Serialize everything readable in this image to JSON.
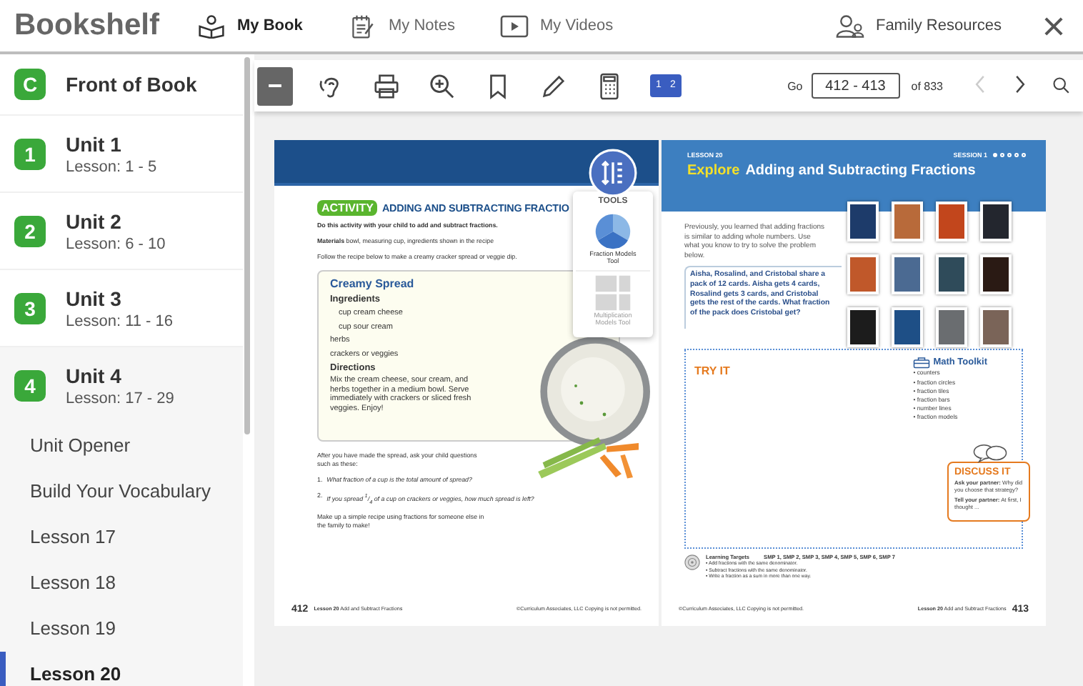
{
  "app": {
    "title": "Bookshelf"
  },
  "nav_tabs": [
    {
      "kind": "book",
      "label": "My Book",
      "selected": true
    },
    {
      "kind": "notes",
      "label": "My Notes",
      "selected": false
    },
    {
      "kind": "videos",
      "label": "My Videos",
      "selected": false
    }
  ],
  "family_resources": {
    "label": "Family Resources"
  },
  "sidebar": {
    "units": [
      {
        "badge": "C",
        "title": "Front of Book",
        "expanded": false
      },
      {
        "badge": "1",
        "title": "Unit 1",
        "subtitle": "Lesson: 1 - 5",
        "expanded": false
      },
      {
        "badge": "2",
        "title": "Unit 2",
        "subtitle": "Lesson: 6 - 10",
        "expanded": false
      },
      {
        "badge": "3",
        "title": "Unit 3",
        "subtitle": "Lesson: 11 - 16",
        "expanded": false
      },
      {
        "badge": "4",
        "title": "Unit 4",
        "subtitle": "Lesson: 17 - 29",
        "expanded": true,
        "children": [
          {
            "label": "Unit Opener",
            "selected": false
          },
          {
            "label": "Build Your Vocabulary",
            "selected": false
          },
          {
            "label": "Lesson 17",
            "selected": false
          },
          {
            "label": "Lesson 18",
            "selected": false
          },
          {
            "label": "Lesson 19",
            "selected": false
          },
          {
            "label": "Lesson 20",
            "selected": true
          }
        ]
      }
    ]
  },
  "toolbar": {
    "tools": [
      {
        "kind": "collapse",
        "selected": true
      },
      {
        "kind": "listen",
        "selected": false
      },
      {
        "kind": "print",
        "selected": false
      },
      {
        "kind": "zoom",
        "selected": false
      },
      {
        "kind": "bookmark",
        "selected": false
      },
      {
        "kind": "pencil",
        "selected": false
      },
      {
        "kind": "calculator",
        "selected": false
      }
    ],
    "two_page": {
      "labels": [
        "1",
        "2"
      ],
      "selected": true
    },
    "go_label": "Go",
    "page_field": "412 - 413",
    "page_total": "of 833",
    "pager": [
      {
        "kind": "prev",
        "disabled": true
      },
      {
        "kind": "next",
        "disabled": false
      }
    ]
  },
  "tools_popup": {
    "title": "TOOLS",
    "items": [
      {
        "kind": "pie",
        "label": "Fraction Models Tool",
        "disabled": false
      },
      {
        "kind": "grid",
        "label": "Multiplication Models Tool",
        "disabled": true
      }
    ]
  },
  "left_page": {
    "badge": "ACTIVITY",
    "title": "ADDING AND SUBTRACTING FRACTIO",
    "intro": "Do this activity with your child to add and subtract fractions.",
    "materials": "**Materials** bowl, measuring cup, ingredients shown in the recipe",
    "follow": "Follow the recipe below to make a creamy cracker spread or veggie dip.",
    "recipe": {
      "title": "Creamy Spread",
      "ingredients_heading": "Ingredients",
      "ingredients": [
        "cup cream cheese",
        "cup sour cream",
        "herbs",
        "crackers or veggies"
      ],
      "directions_heading": "Directions",
      "directions": "Mix the cream cheese, sour cream, and herbs together in a medium bowl. Serve immediately with crackers or sliced fresh veggies. Enjoy!"
    },
    "after": "After you have made the spread, ask your child questions such as these:",
    "questions": [
      {
        "number": "1.",
        "text": "What fraction of a cup is the total amount of spread?"
      },
      {
        "number": "2.",
        "text": "If you spread $^{1}$/$_{4}$ of a cup on crackers or veggies, how much spread is left?"
      }
    ],
    "closing": "Make up a simple recipe using fractions for someone else in the family to make!",
    "page_number": "412",
    "footer_lesson": "**Lesson 20** Add and Subtract Fractions",
    "copyright": "©Curriculum Associates, LLC   Copying is not permitted."
  },
  "right_page": {
    "lesson": "LESSON 20",
    "session": "SESSION 1",
    "session_dots": [
      {
        "filled": true
      },
      {
        "filled": false
      },
      {
        "filled": false
      },
      {
        "filled": false
      },
      {
        "filled": false
      }
    ],
    "title_lead": "Explore",
    "title": "Adding and Subtracting Fractions",
    "intro": "Previously, you learned that adding fractions is similar to adding whole numbers. Use what you know to try to solve the problem below.",
    "problem": "Aisha, Rosalind, and Cristobal share a pack of 12 cards. Aisha gets 4 cards, Rosalind gets 3 cards, and Cristobal gets the rest of the cards. What fraction of the pack does Cristobal get?",
    "try_it": "TRY IT",
    "toolkit_title": "Math Toolkit",
    "toolkit": [
      "• counters",
      "• fraction circles",
      "• fraction tiles",
      "• fraction bars",
      "• number lines",
      "• fraction models"
    ],
    "discuss_title": "DISCUSS IT",
    "discuss": [
      "**Ask your partner:** Why did you choose that strategy?",
      "**Tell your partner:** At first, I thought ..."
    ],
    "targets_title": "Learning Targets",
    "targets_smp": "SMP 1, SMP 2, SMP 3, SMP 4, SMP 5, SMP 6, SMP 7",
    "targets": [
      "• Add fractions with the same denominator.",
      "• Subtract fractions with the same denominator.",
      "• Write a fraction as a sum in more than one way."
    ],
    "copyright": "©Curriculum Associates, LLC   Copying is not permitted.",
    "footer_lesson": "**Lesson 20** Add and Subtract Fractions",
    "page_number": "413"
  }
}
